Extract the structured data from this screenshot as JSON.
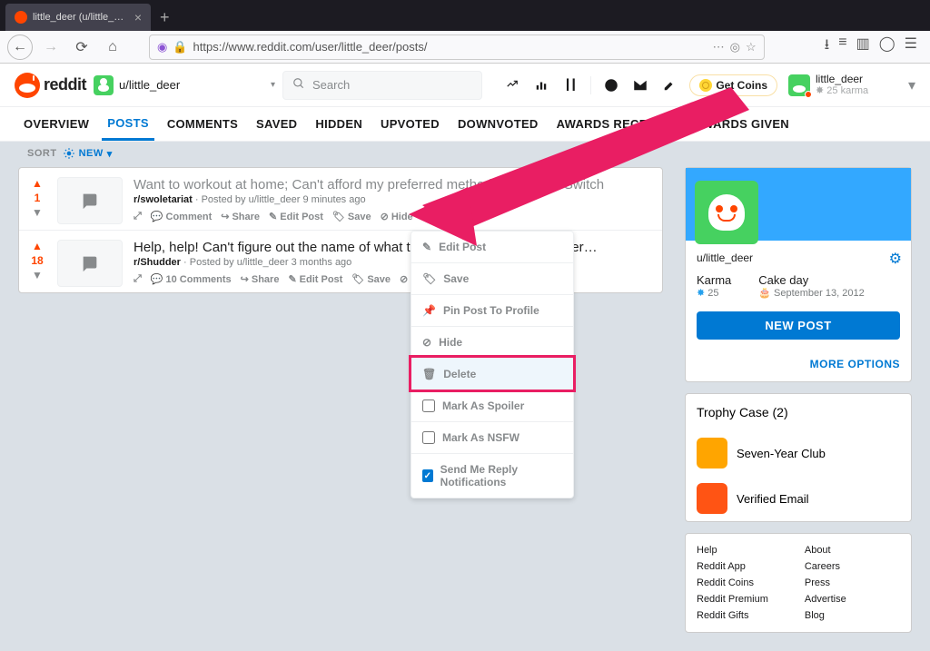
{
  "browser": {
    "tab_title": "little_deer (u/little_deer) - Redd",
    "url": "https://www.reddit.com/user/little_deer/posts/"
  },
  "header": {
    "brand": "reddit",
    "community": "u/little_deer",
    "search_placeholder": "Search",
    "coins_label": "Get Coins",
    "user": {
      "name": "little_deer",
      "karma": "25 karma"
    }
  },
  "tabs": {
    "items": [
      {
        "label": "OVERVIEW",
        "active": false
      },
      {
        "label": "POSTS",
        "active": true
      },
      {
        "label": "COMMENTS",
        "active": false
      },
      {
        "label": "SAVED",
        "active": false
      },
      {
        "label": "HIDDEN",
        "active": false
      },
      {
        "label": "UPVOTED",
        "active": false
      },
      {
        "label": "DOWNVOTED",
        "active": false
      },
      {
        "label": "AWARDS RECEIVED",
        "active": false
      },
      {
        "label": "AWARDS GIVEN",
        "active": false
      }
    ]
  },
  "sort": {
    "label": "SORT",
    "mode": "NEW"
  },
  "posts": [
    {
      "score": "1",
      "title": "Want to workout at home; Can't afford my preferred method—Nintendo Switch",
      "subreddit": "r/swoletariat",
      "byline": "Posted by u/little_deer 9 minutes ago",
      "actions": {
        "comment": "Comment",
        "share": "Share",
        "edit": "Edit Post",
        "save": "Save",
        "hide": "Hide"
      }
    },
    {
      "score": "18",
      "title": "Help, help! Can't figure out the name of what this movie on Netflix Shudder…",
      "subreddit": "r/Shudder",
      "byline": "Posted by u/little_deer 3 months ago",
      "actions": {
        "comment": "10 Comments",
        "share": "Share",
        "edit": "Edit Post",
        "save": "Save",
        "hide": "Hi"
      }
    }
  ],
  "ctxmenu": {
    "edit": "Edit Post",
    "save": "Save",
    "pin": "Pin Post To Profile",
    "hide": "Hide",
    "delete": "Delete",
    "spoiler": "Mark As Spoiler",
    "nsfw": "Mark As NSFW",
    "notify": "Send Me Reply Notifications"
  },
  "sidebar": {
    "user": "u/little_deer",
    "karma_label": "Karma",
    "karma_value": "25",
    "cake_label": "Cake day",
    "cake_value": "September 13, 2012",
    "new_post": "NEW POST",
    "more": "MORE OPTIONS",
    "trophy_title": "Trophy Case (2)",
    "trophies": [
      {
        "name": "Seven-Year Club"
      },
      {
        "name": "Verified Email"
      }
    ],
    "links": {
      "col1": [
        "Help",
        "Reddit App",
        "Reddit Coins",
        "Reddit Premium",
        "Reddit Gifts"
      ],
      "col2": [
        "About",
        "Careers",
        "Press",
        "Advertise",
        "Blog"
      ]
    }
  }
}
